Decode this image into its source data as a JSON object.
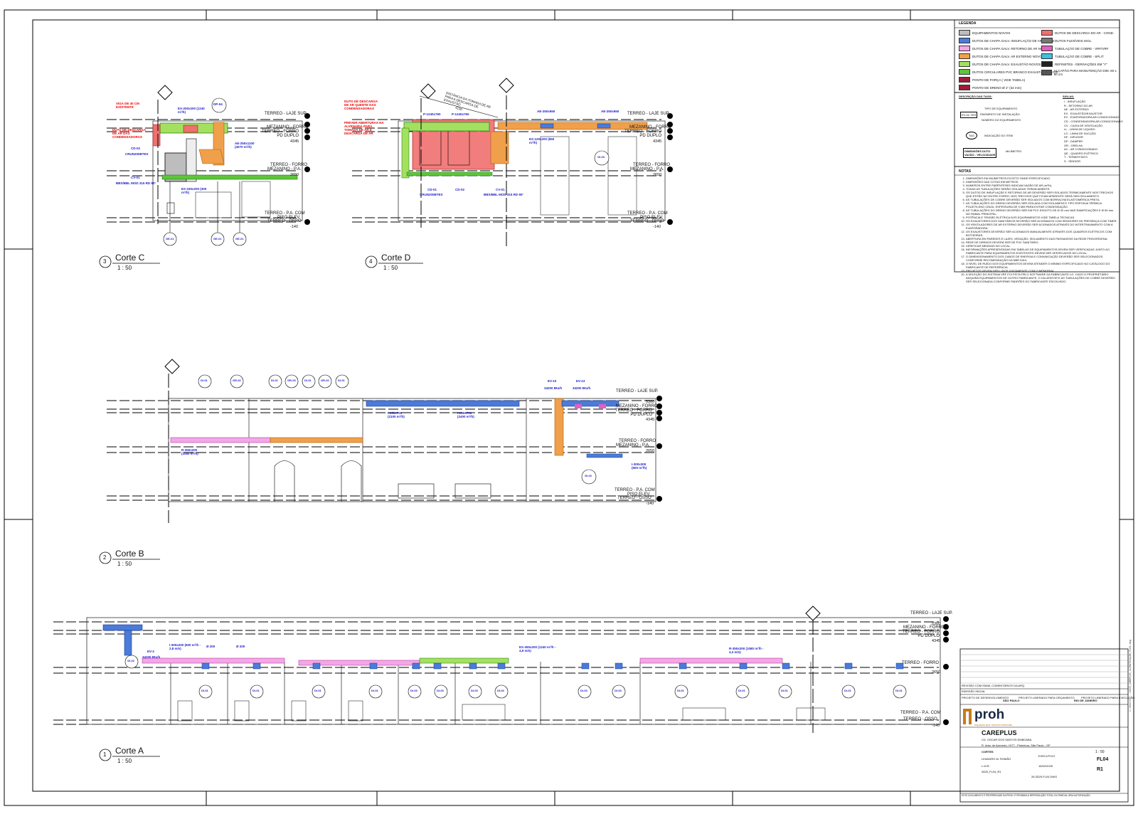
{
  "sheet": {
    "border_color": "#000000"
  },
  "legend": {
    "title": "LEGENDA",
    "items_left": [
      {
        "label": "EQUIPAMENTOS NOVOS",
        "color": "#bdbdbd"
      },
      {
        "label": "DUTOS DE CHAPA GALV. INSUFLAÇÃO DE AR NOVOS",
        "color": "#4a7bd8"
      },
      {
        "label": "DUTOS DE CHAPA GALV. RETORNO DE AR NOVOS",
        "color": "#f4a6e6"
      },
      {
        "label": "DUTOS DE CHAPA GALV. AR EXTERNO NOVOS",
        "color": "#f0a04a"
      },
      {
        "label": "DUTOS DE CHAPA GALV. EXAUSTÃO NOVOS",
        "color": "#a4e060"
      },
      {
        "label": "DUTOS CIRCULARES PVC BRANCO EXAUSTÃO NOVOS",
        "color": "#5fc43a"
      },
      {
        "label": "PONTO DE FORÇA ( VIDE TABELA)",
        "color": "#a01a3a"
      },
      {
        "label": "PONTO DE DRENO Ø 1\" (32 mm)",
        "color": "#a01a3a"
      }
    ],
    "items_right": [
      {
        "label": "DUTOS DE DESCARGA DO AR - COND.",
        "color": "#f07070"
      },
      {
        "label": "DUTOS FLEXÍVEIS ISOL.",
        "color": "#777777"
      },
      {
        "label": "TUBULAÇÃO DE COBRE - VRF/VRF",
        "color": "#e060c0"
      },
      {
        "label": "TUBULAÇÃO DE COBRE - SPLIT",
        "color": "#40c0e0"
      },
      {
        "label": "REFINETES - DERIVAÇÕES EM \"Y\"",
        "color": "#222222"
      },
      {
        "label": "ALÇAPÃO PARA MANUTENÇÃO DIM. 60 x 60 cm",
        "color": "#555555"
      }
    ]
  },
  "descriptions": {
    "title_left": "DESCRIÇÃO DAS TAGS:",
    "title_right": "SIGLAS:",
    "tag_lines": [
      "TIPO DE EQUIPAMENTO",
      "PAVIMENTO DE INSTALAÇÃO",
      "NÚMERO DO EQUIPAMENTO",
      "INDICAÇÃO DO ITEM",
      "DIMENSÕES DUTO",
      "MILÍMETRO"
    ],
    "tag_sample": "EV-01-TER",
    "tag_circle": "TAG",
    "duct_sample": "DIMENSÕES DUTO\nVAZÃO - VELOCIDADE",
    "siglas": [
      "I - INSUFLAÇÃO",
      "R - RETORNO DO AR",
      "AE - AR EXTERNO",
      "EX - EXAUSTÃO/EXAUSTOR",
      "EV - EVAPORADORA AR-CONDICIONADO",
      "CD - CONDENSADORA AR-CONDICIONADO",
      "CV - CAIXA DE VENTILAÇÃO",
      "LL - LINHA DE LÍQUIDO",
      "LS - LINHA DE SUCÇÃO",
      "DF - DIFUSOR",
      "DP - DAMPER",
      "GR - GRELHA",
      "AC - AR CONDICIONADO",
      "QE - QUADRO ELÉTRICO",
      "T - TERMOSTATO",
      "S - SENSOR"
    ]
  },
  "notes": {
    "title": "NOTAS",
    "items": [
      "DIMENSÕES EM MILÍMETROS EXCETO ONDE ESPECIFICADO.",
      "DIMENSÕES DAS COTAS EM METROS.",
      "NÚMEROS ENTRE PARÊNTESES INDICAM VAZÃO DE AR (m³/h).",
      "TODAS AS TUBULAÇÕES SERÃO ISOLADAS TERMICAMENTE.",
      "OS DUTOS DE INSUFLAÇÃO E RETORNO DE AR DEVERÃO SER ISOLADOS TERMICAMENTE NOS TRECHOS QUE ESTÃO NO ENTRE-FORRO, NOS TRECHOS QUE FICAM APARENTE SERÁ SEM ISOLAMENTO.",
      "AS TUBULAÇÕES DE COBRE DEVERÃO SER ISOLADOS COM BORRACHA ELASTOMÉRICA PRETA.",
      "AS TUBULAÇÕES DO DRENO DEVERÃO SER ISOLADA COM ISOLAMENTO TIPO ESPONJA TÉRMICA POLIETILENO CINZA, ESPESSURA DE 9 MM PARA EVITAR CONDENSAÇÃO.",
      "AS TUBULAÇÕES DO DRENO DEVERÃO SER EM PVC ESGOTO DE Ø 32 mm NAS RAMIFICAÇÕES E Ø 50 mm NO RAMAL PRINCIPAL.",
      "POTÊNCIA E TENSÃO ELÉTRICA DOS EQUIPAMENTOS VIDE TABELA TÉCNICAS.",
      "OS EXAUSTORES DOS SANITÁRIOS DEVERÃO SER ACIONADOS COM SENSORES DE PRESENÇA COM TIMER.",
      "OS VENTILADORES DE AR EXTERNO DEVERÃO SER ACIONADOS ATRAVÉS DO INTERTRAVAMENTO COM A EVAPORADORA.",
      "OS EXAUSTORES DEVERÃO SER ACIONADOS MANUALMENTE ATRAVÉS DOS QUADROS ELÉTRICOS COM BOTOEIRAS.",
      "ABERTURA EM PAREDES E LAJES, VEDAÇÃO, ISOLAMENTO DAS PASSAGENS DA REDE FRIGORÍGENA.",
      "REDE DE DRENOS DEVERÁ SER DE PVC SANITÁRIO.",
      "VERIFICAR MEDIDAS NO LOCAL.",
      "INFORMAÇÕES APRESENTADAS EM TABELAS DE EQUIPAMENTOS DEVEM SER VERIFICADAS JUNTO AO FABRICANTE PARA EQUIPAMENTOS EXISTENTES DEVEM SER VERIFICADOS NO LOCAL.",
      "O DIMENSIONAMENTO DOS CABOS DE ENERGIA E COMUNICAÇÃO DEVERÃO SER SELECIONADOS CONFORME RECOMENDAÇÃO DA NBR 5410.",
      "O NÍVEL DE RUÍDO DOS EQUIPAMENTOS DEVEM ATENDER O MÍNIMO ESPECIFICADO NO CATÁLOGO DO FABRICANTE DE REFERÊNCIA.",
      "PROJETOS DEVEM SER LIDOS JUNTAMENTE COM O MEMORIAL.",
      "A SELEÇÃO DO SISTEMA VRF FOI FEITA PELO SOFTWARE DA FABRICANTE LG. CASO O PROPRIETÁRIO ADQUIRA EQUIPAMENTOS DE OUTRO FABRICANTE, O DILUENTOR E AS TUBULAÇÕES DE COBRE DEVERÃO SER SELECIONADA CONFORME PADRÕES DO FABRICANTE ESCOLHIDO."
    ]
  },
  "levels": {
    "laje": "TERREO - LAJE SUP.",
    "laje_sup": "SUP.",
    "mezanino_forro": "MEZANINO - FORRO",
    "terreo_forro_pd": "TERREO - FORRO PD DUPLO",
    "terreo_forro": "TERREO - FORRO",
    "mezanino_pa": "MEZANINO - P.A.",
    "terreo_pa": "TERREO - P.A. COM",
    "piso_elev": "PISO ELEV.",
    "terreo_osso": "TERREO - OSSO",
    "v5360": "5360",
    "v4345": "4345",
    "v2650": "2650",
    "vneg140": "-140"
  },
  "panels": {
    "corteC": {
      "number": "3",
      "title": "Corte C",
      "scale": "1 : 50"
    },
    "corteD": {
      "number": "4",
      "title": "Corte D",
      "scale": "1 : 50"
    },
    "corteB": {
      "number": "2",
      "title": "Corte B",
      "scale": "1 : 50"
    },
    "corteA": {
      "number": "1",
      "title": "Corte A",
      "scale": "1 : 50"
    }
  },
  "annotations_c": {
    "red1": "VIGA DE 40 CM EXISTENTE",
    "red2": "DUTO DE DESCARGA DE AR DAS CONDENSADORAS",
    "ex1": "EX-200x200 (1240 m³/h)",
    "dp": "DP-04",
    "cd": "CD-02",
    "cd_sub": "CRUN200BTES",
    "cv": "CV-01",
    "cv_sub": "BBS/BBL MOD 315 RD 90°",
    "ae": "AE-250x1100 (4070 m³/h)",
    "ex2": "EX-150x200 (300 m³/h)",
    "tags": [
      "GE-01",
      "GE-01",
      "GE-01"
    ]
  },
  "annotations_d": {
    "red1": "DUTO DE DESCARGA DE AR QUENTE DAS CONDENSADORAS",
    "red2": "PREVER ABERTURAS NA ALVENARIA PARA TOMADA DE AR E DESCARGA DE AR",
    "dist": "DISTÂNCIA DA TOMADA DE AR PARA A DESCARGA DE EXAUSTÃO",
    "dist_val": "4130",
    "p1": "P-1240x760",
    "p2": "P-1240x760",
    "ae1": "AE-250x650",
    "ae2": "AE-250x650",
    "ex": "EX-120x200 (650 m³/h)",
    "cd1": "CD-01",
    "cd2": "CD-02",
    "cv": "CV-01",
    "cd_sub": "CRUN200BTES",
    "cv_sub": "BBS/BBL MOD 315 RD 90°",
    "tag": "GI-03"
  },
  "annotations_b": {
    "tags": [
      "DI-01",
      "GR-02",
      "DI-01",
      "GR-03",
      "DI-01",
      "GR-02",
      "DI-01"
    ],
    "ev1": "EV-10",
    "ev1_cap": "34200 Btu/h",
    "ev2": "EV-13",
    "ev2_cap": "34200 Btu/h",
    "i1": "I-250x700 (2100 m³/h)",
    "i2": "I-250x700 (2400 m³/h)",
    "r1": "R-350x200 (1080 m³/h)",
    "i3": "I-300x300 (600 m³/h)",
    "gi": "GI-02"
  },
  "annotations_a": {
    "gi": "GI-02",
    "ev": "EV-3",
    "ev_cap": "34200 Btu/h",
    "i1": "I-300x200 (600 m³/h - 2,8 m/s)",
    "d1": "Ø 200",
    "d2": "Ø 200",
    "ex": "EX-350x200 (1240 m³/h - 4,9 m/s)",
    "r1": "R-350x200 (1080 m³/h - 4,3 m/s)",
    "tags": [
      "DI-01",
      "DI-01",
      "DI-01",
      "DI-01",
      "DI-03",
      "DI-03",
      "DI-03",
      "DI-03",
      "DI-03",
      "DI-03",
      "DI-01",
      "DI-01",
      "DI-01",
      "DI-01",
      "DI-01"
    ]
  },
  "titleblock": {
    "rev1": "REVISÃO COM EMAIL COMENTÁRIOS DA ARQ.",
    "rev0": "EMISSÃO INICIAL",
    "opt1": "PROJETO DE DESENVOLVIMENTO",
    "opt2": "PROJETO LIBERADO PARA ORÇAMENTO",
    "opt3": "PROJETO LIBERADO PARA EXECUÇÃO",
    "office1": "SÃO PAULO",
    "office2": "RIO DE JANEIRO",
    "logo": "proh",
    "tagline": "espaços que movem histórias",
    "project": "CAREPLUS",
    "client_line": "CD. OSCAR DOS SANTOS EMBOABA",
    "address": "R. Artur de Azevedo, 1977 - Pinheiros, São Paulo - SP",
    "discipline": "CORTES",
    "author": "LEANDRO M. ROMÃO",
    "checker": "L.M.R.",
    "phase": "EXECUTIVO",
    "date": "16/02/2025",
    "sheet": "FL04",
    "scale": "1 : 50",
    "rev": "R1",
    "code": "2825_FL04_R1",
    "file": "26.3D20.FL04.DWG",
    "footer": "ESTE DOCUMENTO É PROPRIEDADE DA PROH. É PROIBIDA A REPRODUÇÃO TOTAL OU PARCIAL SEM AUTORIZAÇÃO."
  },
  "side_text": "C:\\Users\\...\\2825_CAREPLUS_CLIMATIZAÇÃO_FL04.dwg"
}
